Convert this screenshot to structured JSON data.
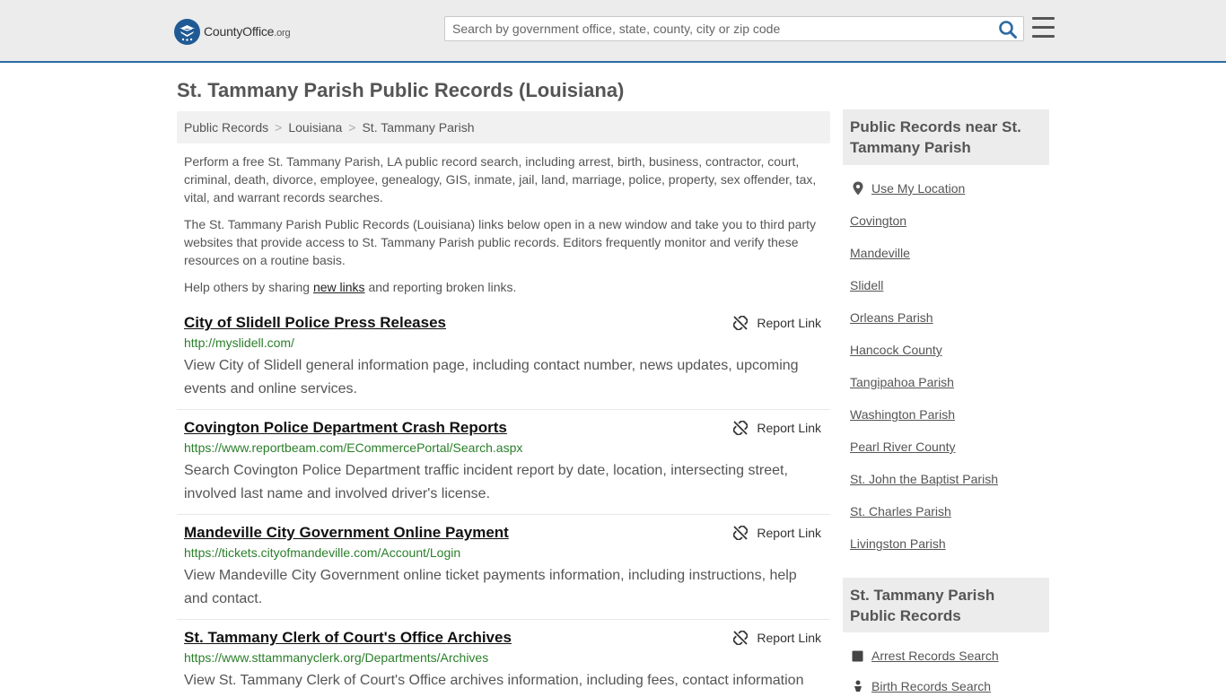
{
  "header": {
    "logo_name": "CountyOffice",
    "logo_tld": ".org",
    "search_placeholder": "Search by government office, state, county, city or zip code"
  },
  "page": {
    "title": "St. Tammany Parish Public Records (Louisiana)"
  },
  "breadcrumb": [
    "Public Records",
    "Louisiana",
    "St. Tammany Parish"
  ],
  "intro": {
    "p1": "Perform a free St. Tammany Parish, LA public record search, including arrest, birth, business, contractor, court, criminal, death, divorce, employee, genealogy, GIS, inmate, jail, land, marriage, police, property, sex offender, tax, vital, and warrant records searches.",
    "p2": "The St. Tammany Parish Public Records (Louisiana) links below open in a new window and take you to third party websites that provide access to St. Tammany Parish public records. Editors frequently monitor and verify these resources on a routine basis.",
    "p3_before": "Help others by sharing ",
    "p3_link": "new links",
    "p3_after": " and reporting broken links."
  },
  "report_label": "Report Link",
  "records": [
    {
      "title": "City of Slidell Police Press Releases",
      "url": "http://myslidell.com/",
      "desc": "View City of Slidell general information page, including contact number, news updates, upcoming events and online services."
    },
    {
      "title": "Covington Police Department Crash Reports",
      "url": "https://www.reportbeam.com/ECommercePortal/Search.aspx",
      "desc": "Search Covington Police Department traffic incident report by date, location, intersecting street, involved last name and involved driver's license."
    },
    {
      "title": "Mandeville City Government Online Payment",
      "url": "https://tickets.cityofmandeville.com/Account/Login",
      "desc": "View Mandeville City Government online ticket payments information, including instructions, help and contact."
    },
    {
      "title": "St. Tammany Clerk of Court's Office Archives",
      "url": "https://www.sttammanyclerk.org/Departments/Archives",
      "desc": "View St. Tammany Clerk of Court's Office archives information, including fees, contact information"
    }
  ],
  "sidebar": {
    "nearby_heading": "Public Records near St. Tammany Parish",
    "use_location": "Use My Location",
    "nearby": [
      "Covington",
      "Mandeville",
      "Slidell",
      "Orleans Parish",
      "Hancock County",
      "Tangipahoa Parish",
      "Washington Parish",
      "Pearl River County",
      "St. John the Baptist Parish",
      "St. Charles Parish",
      "Livingston Parish"
    ],
    "records_heading": "St. Tammany Parish Public Records",
    "records_links": [
      "Arrest Records Search",
      "Birth Records Search"
    ]
  },
  "colors": {
    "accent": "#2d6ca2",
    "url_green": "#2a7f2a",
    "logo_blue": "#1f5a94"
  }
}
